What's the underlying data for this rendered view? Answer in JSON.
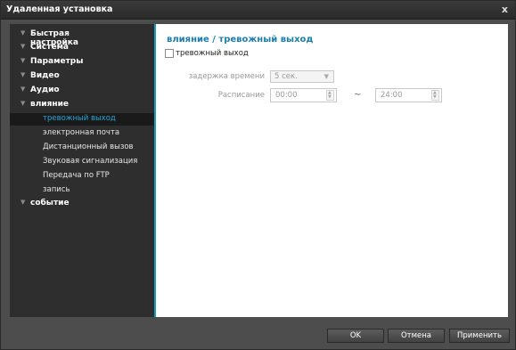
{
  "window": {
    "title": "Удаленная установка",
    "close": "x"
  },
  "sidebar": {
    "sections": [
      {
        "label": "Быстрая настройка"
      },
      {
        "label": "Система"
      },
      {
        "label": "Параметры"
      },
      {
        "label": "Видео"
      },
      {
        "label": "Аудио"
      },
      {
        "label": "влияние"
      },
      {
        "label": "событие"
      }
    ],
    "subitems": [
      {
        "label": "тревожный выход",
        "selected": true
      },
      {
        "label": "электронная почта"
      },
      {
        "label": "Дистанционный вызов"
      },
      {
        "label": "Звуковая сигнализация"
      },
      {
        "label": "Передача по FTP"
      },
      {
        "label": "запись"
      }
    ]
  },
  "main": {
    "title": "влияние / тревожный выход",
    "alarm_checkbox_label": "тревожный выход",
    "delay_label": "задержка времени",
    "delay_value": "5 сек.",
    "schedule_label": "Расписание",
    "schedule_start": "00:00",
    "schedule_sep": "~",
    "schedule_end": "24:00"
  },
  "footer": {
    "ok": "OK",
    "cancel": "Отмена",
    "apply": "Применить"
  },
  "colors": {
    "accent": "#1a9bc4",
    "selected_text": "#27a6d6"
  }
}
